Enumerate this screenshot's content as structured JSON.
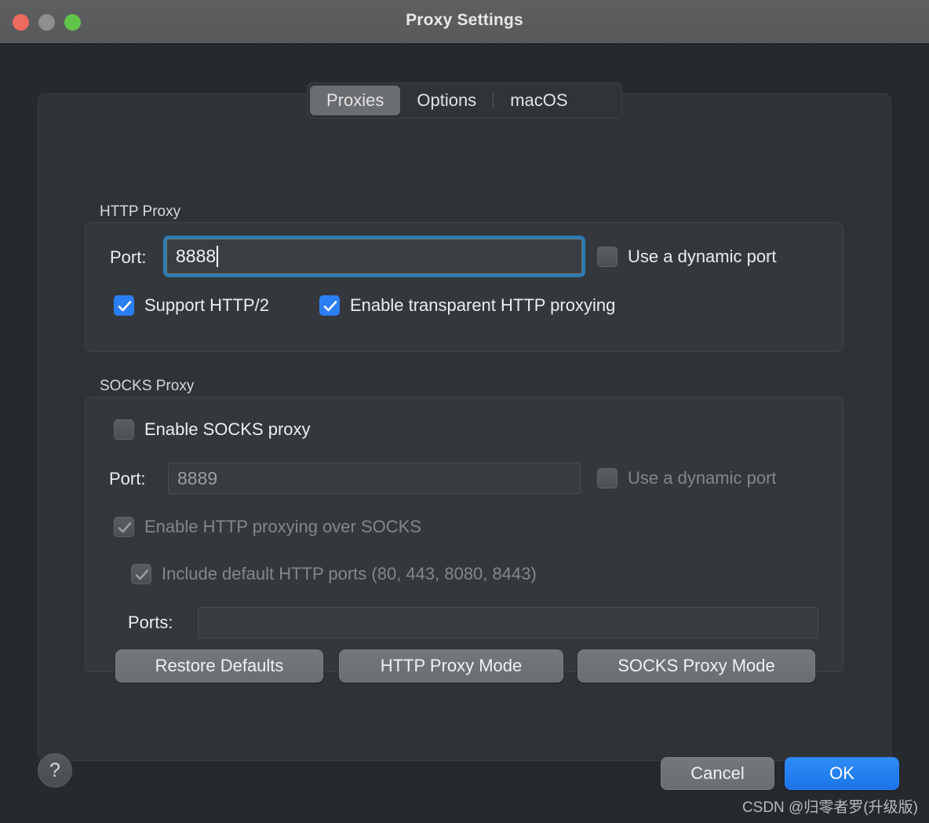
{
  "window": {
    "title": "Proxy Settings",
    "traffic_lights": [
      "close-button",
      "minimize-button",
      "zoom-button"
    ]
  },
  "tabs": [
    {
      "label": "Proxies",
      "active": true
    },
    {
      "label": "Options",
      "active": false
    },
    {
      "label": "macOS",
      "active": false
    }
  ],
  "http_proxy": {
    "group_label": "HTTP Proxy",
    "port_label": "Port:",
    "port_value": "8888",
    "dynamic_port_label": "Use a dynamic port",
    "dynamic_port_checked": false,
    "support_http2_label": "Support HTTP/2",
    "support_http2_checked": true,
    "transparent_label": "Enable transparent HTTP proxying",
    "transparent_checked": true
  },
  "socks_proxy": {
    "group_label": "SOCKS Proxy",
    "enable_label": "Enable SOCKS proxy",
    "enable_checked": false,
    "port_label": "Port:",
    "port_value": "8889",
    "dynamic_port_label": "Use a dynamic port",
    "dynamic_port_checked": false,
    "http_over_socks_label": "Enable HTTP proxying over SOCKS",
    "http_over_socks_checked": true,
    "include_default_ports_label": "Include default HTTP ports (80, 443, 8080, 8443)",
    "include_default_ports_checked": true,
    "ports_label": "Ports:",
    "ports_value": ""
  },
  "action_buttons": [
    {
      "label": "Restore Defaults"
    },
    {
      "label": "HTTP Proxy Mode"
    },
    {
      "label": "SOCKS Proxy Mode"
    }
  ],
  "footer": {
    "help_glyph": "?",
    "cancel_label": "Cancel",
    "ok_label": "OK",
    "watermark": "CSDN @归零者罗(升级版)"
  },
  "colors": {
    "accent_blue": "#2b7ff5",
    "focus_ring": "#2b7cb5",
    "window_bg": "#262a2e",
    "panel_bg": "#2f3337",
    "group_bg": "#34383c",
    "titlebar_bg": "#5d5f61"
  }
}
